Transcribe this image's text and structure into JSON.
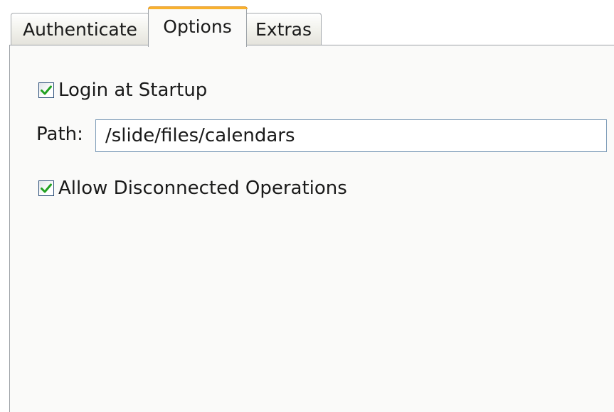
{
  "tabs": [
    {
      "label": "Authenticate",
      "active": false
    },
    {
      "label": "Options",
      "active": true
    },
    {
      "label": "Extras",
      "active": false
    }
  ],
  "options": {
    "login_at_startup": {
      "label": "Login at Startup",
      "checked": true
    },
    "path": {
      "label": "Path:",
      "value": "/slide/files/calendars"
    },
    "allow_disconnected": {
      "label": "Allow Disconnected Operations",
      "checked": true
    }
  },
  "colors": {
    "active_tab_accent": "#f8b12d",
    "checkmark": "#21a121",
    "checkbox_border": "#2c4f7a",
    "input_border": "#7f9db9"
  }
}
